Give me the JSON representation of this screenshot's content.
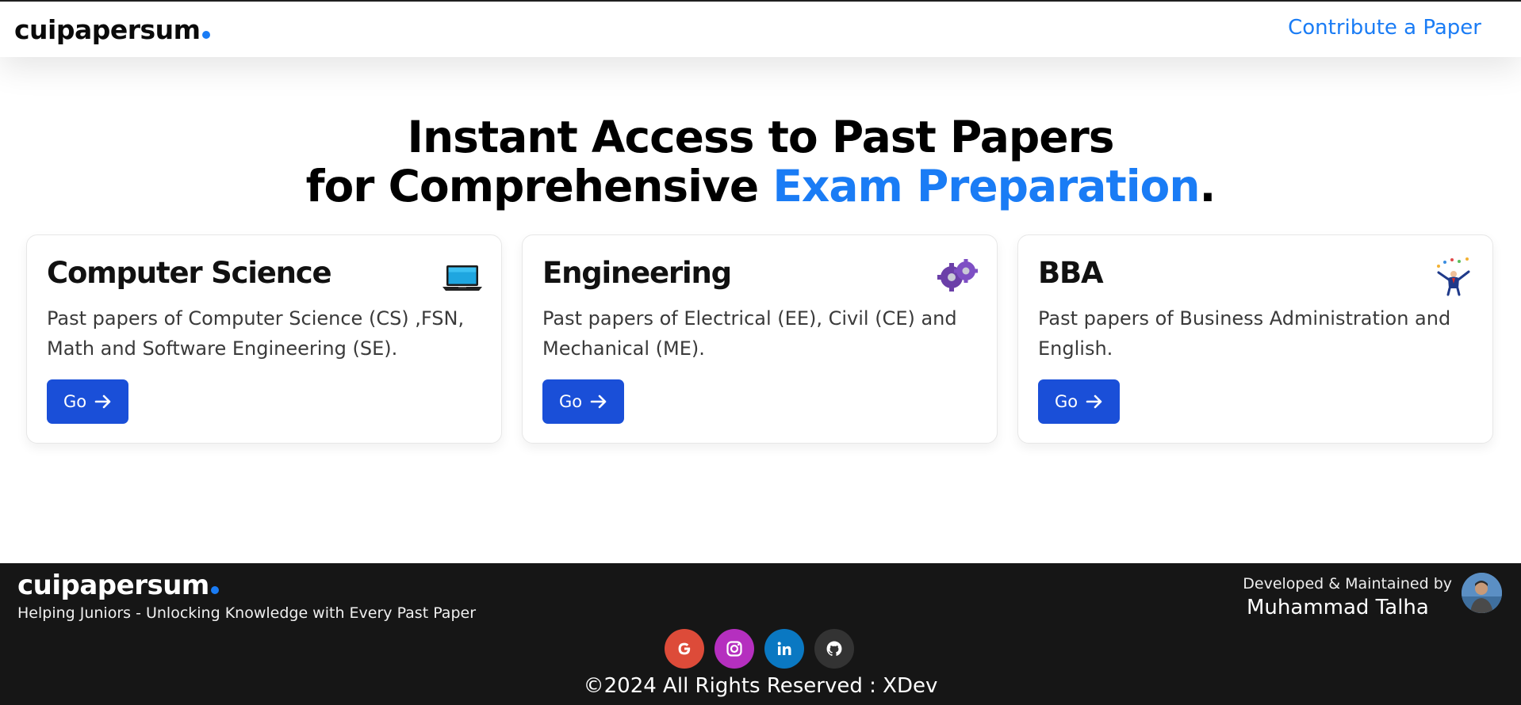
{
  "navbar": {
    "logo_text": "cuipapersum",
    "contribute_label": "Contribute a Paper"
  },
  "hero": {
    "line1": "Instant Access to Past Papers",
    "line2_prefix": "for Comprehensive ",
    "line2_accent": "Exam Preparation",
    "line2_suffix": "."
  },
  "cards": [
    {
      "title": "Computer Science",
      "description": "Past papers of Computer Science (CS) ,FSN, Math and Software Engineering (SE).",
      "button_label": "Go",
      "icon": "laptop-icon"
    },
    {
      "title": "Engineering",
      "description": "Past papers of Electrical (EE), Civil (CE) and Mechanical (ME).",
      "button_label": "Go",
      "icon": "gears-icon"
    },
    {
      "title": "BBA",
      "description": "Past papers of Business Administration and English.",
      "button_label": "Go",
      "icon": "businessman-icon"
    }
  ],
  "footer": {
    "logo_text": "cuipapersum",
    "tagline": "Helping Juniors - Unlocking Knowledge with Every Past Paper",
    "developed_by_label": "Developed & Maintained by",
    "developer_name": "Muhammad Talha",
    "socials": [
      {
        "name": "google-icon",
        "color": "#dd4b39"
      },
      {
        "name": "instagram-icon",
        "color": "#b52fbf"
      },
      {
        "name": "linkedin-icon",
        "color": "#0a78c2"
      },
      {
        "name": "github-icon",
        "color": "#333333"
      }
    ],
    "copyright": "©2024 All Rights Reserved : XDev"
  },
  "colors": {
    "accent": "#1a7cf5",
    "button": "#1a4fd8",
    "footer_bg": "#161616"
  }
}
